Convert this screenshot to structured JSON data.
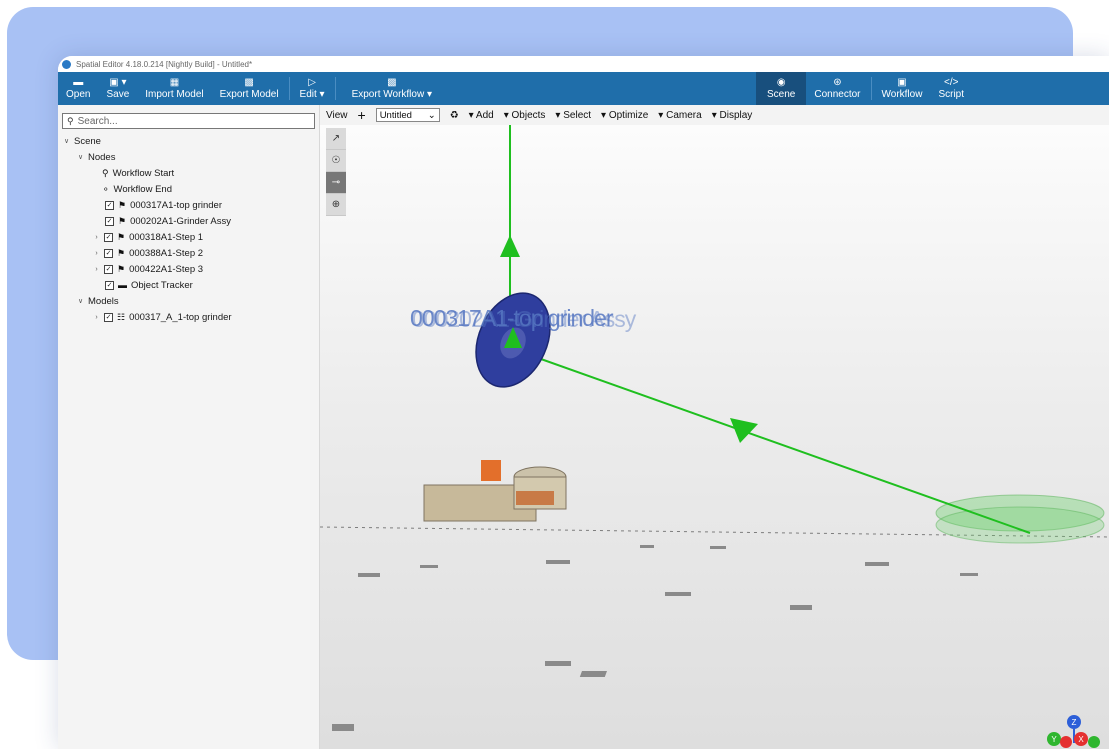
{
  "window": {
    "title": "Spatial Editor 4.18.0.214 [Nightly Build] - Untitled*"
  },
  "ribbon": {
    "open": "Open",
    "save": "Save",
    "import_model": "Import Model",
    "export_model": "Export Model",
    "edit": "Edit ▾",
    "export_workflow": "Export Workflow ▾",
    "scene": "Scene",
    "connector": "Connector",
    "workflow": "Workflow",
    "script": "Script"
  },
  "sidebar": {
    "search_placeholder": "Search...",
    "scene_label": "Scene",
    "nodes_label": "Nodes",
    "nodes": [
      "Workflow Start",
      "Workflow End",
      "000317A1-top grinder",
      "000202A1-Grinder Assy",
      "000318A1-Step 1",
      "000388A1-Step 2",
      "000422A1-Step 3",
      "Object Tracker"
    ],
    "models_label": "Models",
    "models": [
      "000317_A_1-top grinder"
    ]
  },
  "viewport": {
    "view": "View",
    "add_icon": "+",
    "select_value": "Untitled",
    "add": "Add",
    "objects": "Objects",
    "select": "Select",
    "optimize": "Optimize",
    "camera": "Camera",
    "display": "Display",
    "label_a": "000317A1-top grinder",
    "label_b": "000202A1-Grinder Assy",
    "axis_z": "Z",
    "axis_y": "Y",
    "axis_x": "X"
  },
  "colors": {
    "ribbon": "#1f6eaa",
    "accent_bg": "#a8c1f4",
    "path": "#1fbf1f",
    "axis_x": "#e53030",
    "axis_y": "#2fb62f",
    "axis_z": "#2d5fd8"
  },
  "icons": [
    "folder-icon",
    "save-icon",
    "import-icon",
    "export-icon",
    "edit-icon",
    "export-workflow-icon",
    "scene-icon",
    "connector-icon",
    "workflow-icon",
    "script-icon"
  ]
}
